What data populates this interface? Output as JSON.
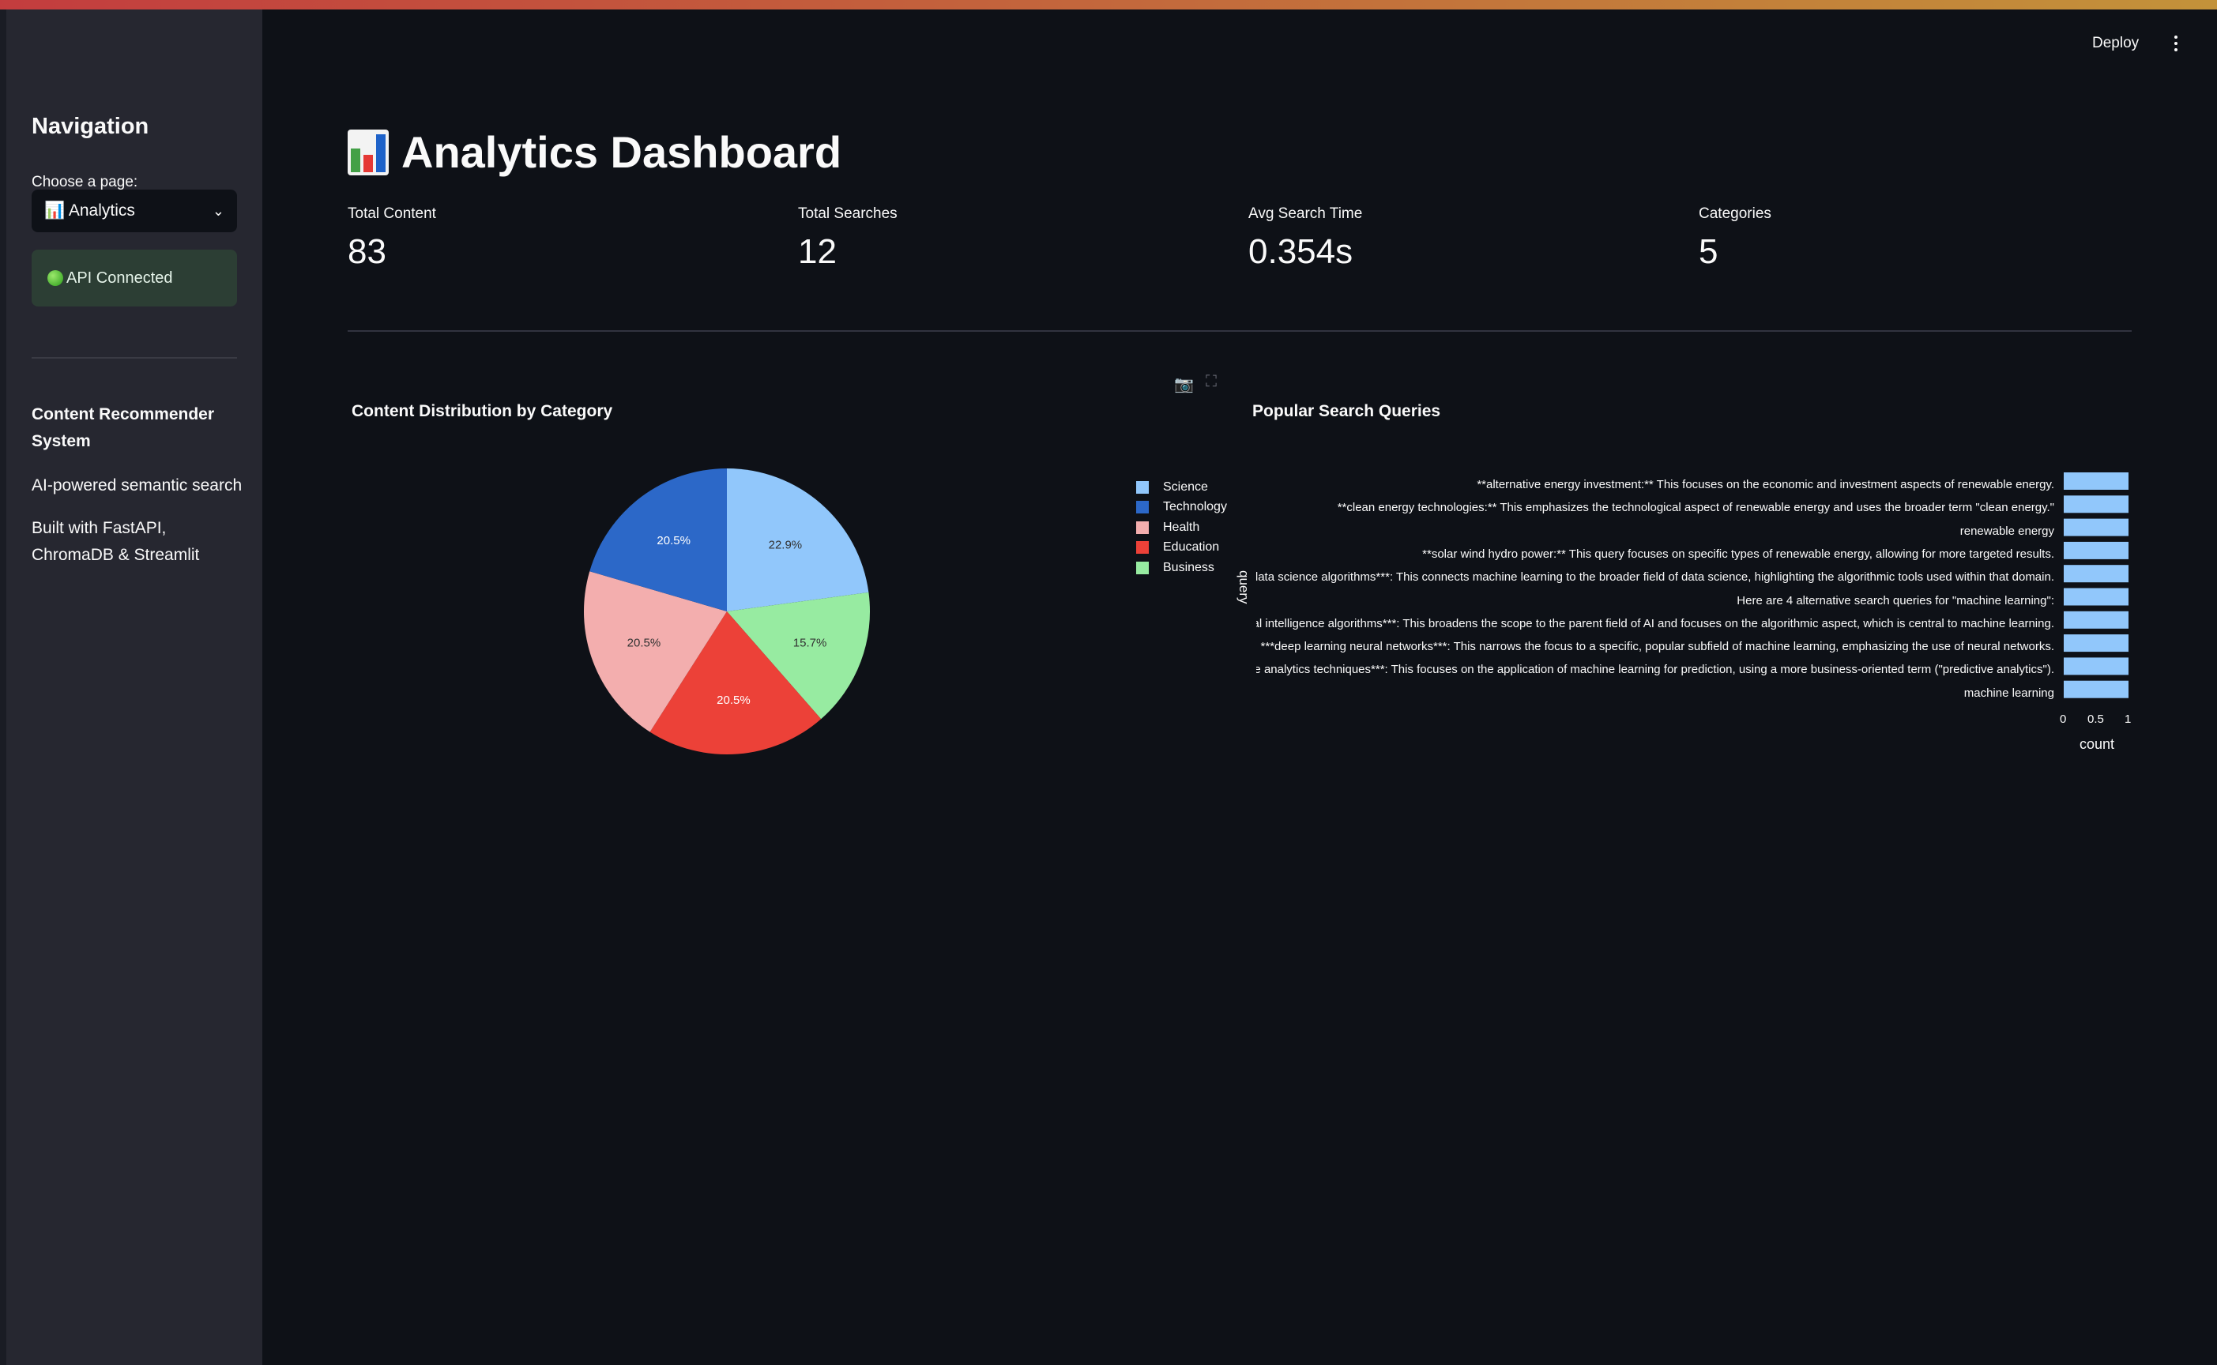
{
  "sidebar": {
    "title": "Navigation",
    "select_label": "Choose a page:",
    "selected_page": "📊 Analytics",
    "status": "API Connected",
    "app_name": "Content Recommender System",
    "tagline": "AI-powered semantic search",
    "built_with": "Built with FastAPI, ChromaDB & Streamlit"
  },
  "header": {
    "deploy_label": "Deploy"
  },
  "main": {
    "title": "Analytics Dashboard",
    "metrics": [
      {
        "label": "Total Content",
        "value": "83"
      },
      {
        "label": "Total Searches",
        "value": "12"
      },
      {
        "label": "Avg Search Time",
        "value": "0.354s"
      },
      {
        "label": "Categories",
        "value": "5"
      }
    ]
  },
  "colors": {
    "Science": "#91c7fb",
    "Technology": "#2c68c8",
    "Health": "#f3aeae",
    "Education": "#ec4138",
    "Business": "#97eba1"
  },
  "chart_data": [
    {
      "type": "pie",
      "title": "Content Distribution by Category",
      "categories": [
        "Science",
        "Business",
        "Education",
        "Health",
        "Technology"
      ],
      "values": [
        22.9,
        15.7,
        20.5,
        20.5,
        20.5
      ],
      "labels": [
        "22.9%",
        "15.7%",
        "20.5%",
        "20.5%",
        "20.5%"
      ],
      "legend": [
        "Science",
        "Technology",
        "Health",
        "Education",
        "Business"
      ],
      "legend_position": "right"
    },
    {
      "type": "bar",
      "orientation": "horizontal",
      "title": "Popular Search Queries",
      "xlabel": "count",
      "ylabel": "query",
      "xlim": [
        0,
        1
      ],
      "x_ticks": [
        "0",
        "0.5",
        "1"
      ],
      "categories": [
        "**alternative energy investment:** This focuses on the economic and investment aspects of renewable energy.",
        "**clean energy technologies:** This emphasizes the technological aspect of renewable energy and uses the broader term \"clean energy.\"",
        "renewable energy",
        "**solar wind hydro power:** This query focuses on specific types of renewable energy, allowing for more targeted results.",
        "***data science algorithms***: This connects machine learning to the broader field of data science, highlighting the algorithmic tools used within that domain.",
        "Here are 4 alternative search queries for \"machine learning\":",
        "***artificial intelligence algorithms***: This broadens the scope to the parent field of AI and focuses on the algorithmic aspect, which is central to machine learning.",
        "***deep learning neural networks***: This narrows the focus to a specific, popular subfield of machine learning, emphasizing the use of neural networks.",
        "***predictive analytics techniques***: This focuses on the application of machine learning for prediction, using a more business-oriented term (\"predictive analytics\").",
        "machine learning"
      ],
      "values": [
        1,
        1,
        1,
        1,
        1,
        1,
        1,
        1,
        1,
        1
      ]
    }
  ]
}
